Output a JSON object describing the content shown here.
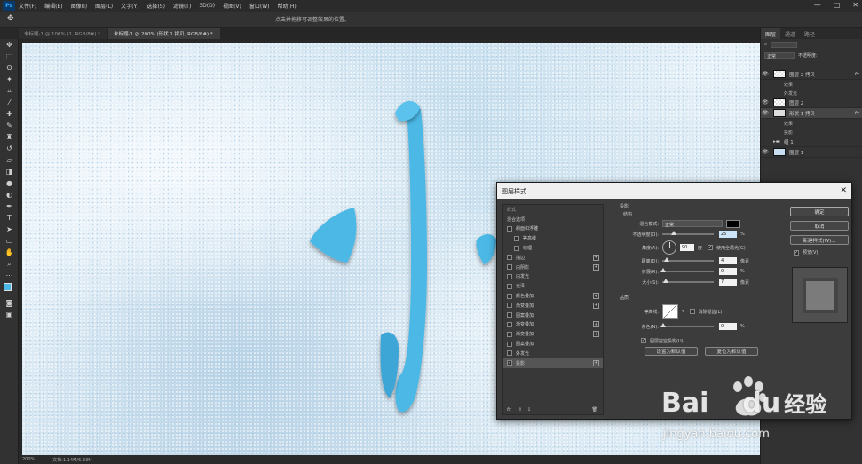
{
  "app": {
    "logo": "Ps",
    "doc_title_hint": "点击并拖移可调整效果的位置。"
  },
  "menu": [
    "文件(F)",
    "编辑(E)",
    "图像(I)",
    "图层(L)",
    "文字(Y)",
    "选择(S)",
    "滤镜(T)",
    "3D(D)",
    "视图(V)",
    "窗口(W)",
    "帮助(H)"
  ],
  "window_controls": {
    "minimize": "—",
    "maximize": "□",
    "close": "✕"
  },
  "tabs": [
    "未标题-1 @ 100% (1, RGB/8#) *",
    "未标题-1 @ 200% (形状 1 拷贝, RGB/8#) *"
  ],
  "status": {
    "zoom": "200%",
    "doc": "文档:1.14M/6.83M"
  },
  "panel": {
    "tabs": [
      "图层",
      "通道",
      "路径"
    ],
    "mode": "正常",
    "opacity_label": "不透明度:",
    "layers": [
      {
        "name": "图层 2 拷贝",
        "fx": "fx",
        "sub": [
          "效果",
          "外发光"
        ]
      },
      {
        "name": "图层 2",
        "fx": ""
      },
      {
        "name": "形状 1 拷贝",
        "fx": "fx",
        "sub": [
          "效果",
          "投影"
        ],
        "selected": true
      },
      {
        "name": "组 1",
        "fx": ""
      },
      {
        "name": "图层 1",
        "fx": ""
      }
    ]
  },
  "dialog": {
    "title": "图层样式",
    "close": "✕",
    "styles_header": "样式",
    "blend_options": "混合选项",
    "styles": [
      {
        "label": "斜面和浮雕",
        "checked": false,
        "plus": false
      },
      {
        "label": "等高线",
        "checked": false,
        "plus": false,
        "indent": true
      },
      {
        "label": "纹理",
        "checked": false,
        "plus": false,
        "indent": true
      },
      {
        "label": "描边",
        "checked": false,
        "plus": true
      },
      {
        "label": "内阴影",
        "checked": false,
        "plus": true
      },
      {
        "label": "内发光",
        "checked": false,
        "plus": false
      },
      {
        "label": "光泽",
        "checked": false,
        "plus": false
      },
      {
        "label": "颜色叠加",
        "checked": false,
        "plus": true
      },
      {
        "label": "渐变叠加",
        "checked": false,
        "plus": true
      },
      {
        "label": "图案叠加",
        "checked": false,
        "plus": false
      },
      {
        "label": "渐变叠加",
        "checked": false,
        "plus": true
      },
      {
        "label": "渐变叠加",
        "checked": false,
        "plus": true
      },
      {
        "label": "图案叠加",
        "checked": false,
        "plus": false
      },
      {
        "label": "外发光",
        "checked": false,
        "plus": false
      },
      {
        "label": "投影",
        "checked": true,
        "plus": true,
        "selected": true
      }
    ],
    "section_title": "投影",
    "structure": "结构",
    "blend_mode_label": "混合模式:",
    "blend_mode": "正常",
    "opacity_label": "不透明度(O):",
    "opacity": "25",
    "angle_label": "角度(A):",
    "angle": "90",
    "angle_unit": "度",
    "global_light": "使用全局光(G)",
    "distance_label": "距离(D):",
    "distance": "4",
    "spread_label": "扩展(R):",
    "spread": "0",
    "size_label": "大小(S):",
    "size": "7",
    "px": "像素",
    "pct": "%",
    "quality": "品质",
    "contour_label": "等高线:",
    "antialias": "消除锯齿(L)",
    "noise_label": "杂色(N):",
    "noise": "0",
    "layer_knockout": "图层挖空投影(U)",
    "set_default": "设置为默认值",
    "reset_default": "复位为默认值",
    "ok": "确定",
    "cancel": "取消",
    "new_style": "新建样式(W)...",
    "preview": "预览(V)",
    "fx_icon": "fx"
  },
  "watermark": {
    "brand": "Bai",
    "brand_du": "du",
    "brand_cn": "经验",
    "url": "jingyan.baidu.com"
  },
  "colors": {
    "accent": "#31a8ff",
    "shape": "#4bb8e6",
    "shadow_color": "#000000"
  }
}
